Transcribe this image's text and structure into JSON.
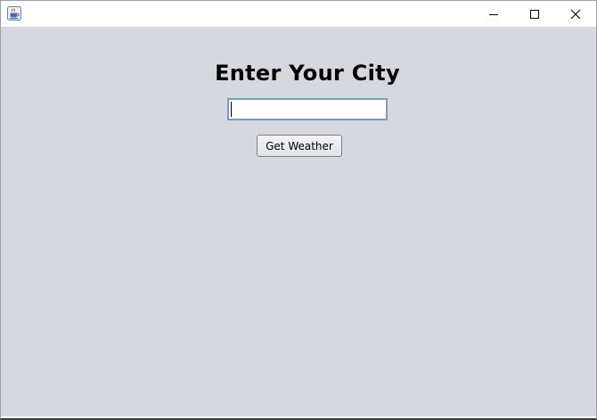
{
  "window": {
    "app_icon": "java-coffee-cup-icon",
    "controls": {
      "minimize_icon": "minimize-icon",
      "maximize_icon": "maximize-icon",
      "close_icon": "close-icon"
    }
  },
  "form": {
    "heading": "Enter Your City",
    "city_value": "",
    "button_label": "Get Weather"
  },
  "colors": {
    "content_background": "#d6d8df",
    "titlebar_background": "#ffffff",
    "input_border": "#7c9cbf"
  }
}
